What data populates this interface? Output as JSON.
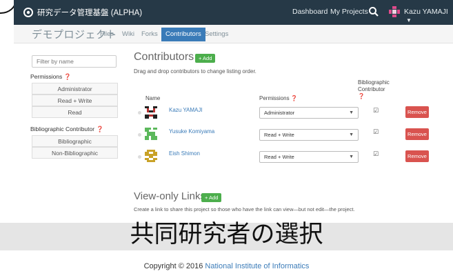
{
  "navbar": {
    "brand": "研究データ管理基盤 (ALPHA)",
    "links": [
      "Dashboard",
      "My Projects"
    ],
    "user_name": "Kazu YAMAJI"
  },
  "project": {
    "title": "デモプロジェクト",
    "tabs": [
      {
        "label": "Files",
        "active": false
      },
      {
        "label": "Wiki",
        "active": false
      },
      {
        "label": "Forks",
        "active": false
      },
      {
        "label": "Contributors",
        "active": true
      },
      {
        "label": "Settings",
        "active": false
      }
    ]
  },
  "sidebar": {
    "filter_placeholder": "Filter by name",
    "permissions_heading": "Permissions",
    "permission_filters": [
      "Administrator",
      "Read + Write",
      "Read"
    ],
    "biblio_heading": "Bibliographic Contributor",
    "biblio_filters": [
      "Bibliographic",
      "Non-Bibliographic"
    ]
  },
  "contributors": {
    "title": "Contributors",
    "add_label": "+ Add",
    "hint": "Drag and drop contributors to change listing order.",
    "col_name": "Name",
    "col_permissions": "Permissions",
    "col_biblio_line1": "Bibliographic",
    "col_biblio_line2": "Contributor",
    "rows": [
      {
        "name": "Kazu YAMAJI",
        "permission": "Administrator",
        "bibliographic": true,
        "remove_label": "Remove"
      },
      {
        "name": "Yusuke Komiyama",
        "permission": "Read + Write",
        "bibliographic": true,
        "remove_label": "Remove"
      },
      {
        "name": "Eish Shimon",
        "permission": "Read + Write",
        "bibliographic": true,
        "remove_label": "Remove"
      }
    ]
  },
  "view_only": {
    "title": "View-only Links",
    "add_label": "+ Add",
    "description": "Create a link to share this project so those who have the link can view—but not edit—the project."
  },
  "overlay_caption": "共同研究者の選択",
  "footer": {
    "prefix": "Copyright © 2016 ",
    "org": "National Institute of Informatics"
  },
  "colors": {
    "navbar": "#263947",
    "accent": "#3a7bb8",
    "add_green": "#4cae4c",
    "remove_red": "#d9534f"
  }
}
